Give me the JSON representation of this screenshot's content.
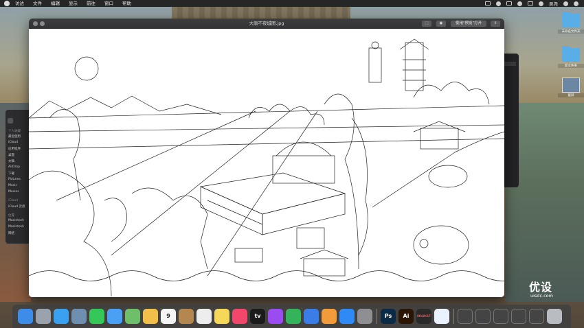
{
  "menubar": {
    "items": [
      "访达",
      "文件",
      "编辑",
      "显示",
      "前往",
      "窗口",
      "帮助"
    ],
    "user": "吴尧"
  },
  "finder_sidebar": {
    "section_favorites": "个人收藏",
    "favorites": [
      "最近使用",
      "iCloud",
      "应用程序",
      "桌面",
      "文稿",
      "AirDrop",
      "下载",
      "Pictures",
      "Music",
      "Movies"
    ],
    "section_icloud": "iCloud",
    "icloud": [
      "iCloud 云盘"
    ],
    "section_locations": "位置",
    "locations": [
      "Macintosh",
      "Macintosh",
      "网络"
    ]
  },
  "preview": {
    "title": "大唐不夜城图.jpg",
    "open_with_label": "使用\"预览\"打开"
  },
  "desktop_icons": [
    {
      "label": "未命名文件夹"
    },
    {
      "label": "新文件夹"
    },
    {
      "label": "截屏"
    }
  ],
  "watermark": {
    "brand": "优设",
    "domain": "uisdc.com"
  },
  "dock": {
    "apps": [
      {
        "name": "finder",
        "color": "#3d8ce8",
        "text": ""
      },
      {
        "name": "launchpad",
        "color": "#9aa3ad",
        "text": ""
      },
      {
        "name": "safari",
        "color": "#3aa0f0",
        "text": ""
      },
      {
        "name": "preview",
        "color": "#6e8fb0",
        "text": ""
      },
      {
        "name": "messages",
        "color": "#36c759",
        "text": ""
      },
      {
        "name": "mail",
        "color": "#4aa0f5",
        "text": ""
      },
      {
        "name": "maps",
        "color": "#6fbf6a",
        "text": ""
      },
      {
        "name": "photos",
        "color": "#f2c04a",
        "text": ""
      },
      {
        "name": "calendar",
        "color": "#f4f4f4",
        "text": "9"
      },
      {
        "name": "notes-brown",
        "color": "#b48650",
        "text": ""
      },
      {
        "name": "reminders",
        "color": "#ededed",
        "text": ""
      },
      {
        "name": "notes",
        "color": "#f5d75a",
        "text": ""
      },
      {
        "name": "music",
        "color": "#f2466a",
        "text": ""
      },
      {
        "name": "tv",
        "color": "#1b1b1b",
        "text": "tv"
      },
      {
        "name": "podcasts",
        "color": "#9a4cf0",
        "text": ""
      },
      {
        "name": "numbers",
        "color": "#34b35a",
        "text": ""
      },
      {
        "name": "keynote",
        "color": "#3b7de6",
        "text": ""
      },
      {
        "name": "pages",
        "color": "#f29b3a",
        "text": ""
      },
      {
        "name": "app-store",
        "color": "#2f8af5",
        "text": ""
      },
      {
        "name": "system-preferences",
        "color": "#8e8e93",
        "text": ""
      },
      {
        "name": "photoshop",
        "color": "#0b2a45",
        "text": "Ps"
      },
      {
        "name": "illustrator",
        "color": "#2b1505",
        "text": "Ai"
      },
      {
        "name": "recorder",
        "color": "#2a2a2a",
        "text": "00:40:17"
      },
      {
        "name": "baidu-netdisk",
        "color": "#eaf2ff",
        "text": ""
      }
    ],
    "trash": "trash"
  }
}
